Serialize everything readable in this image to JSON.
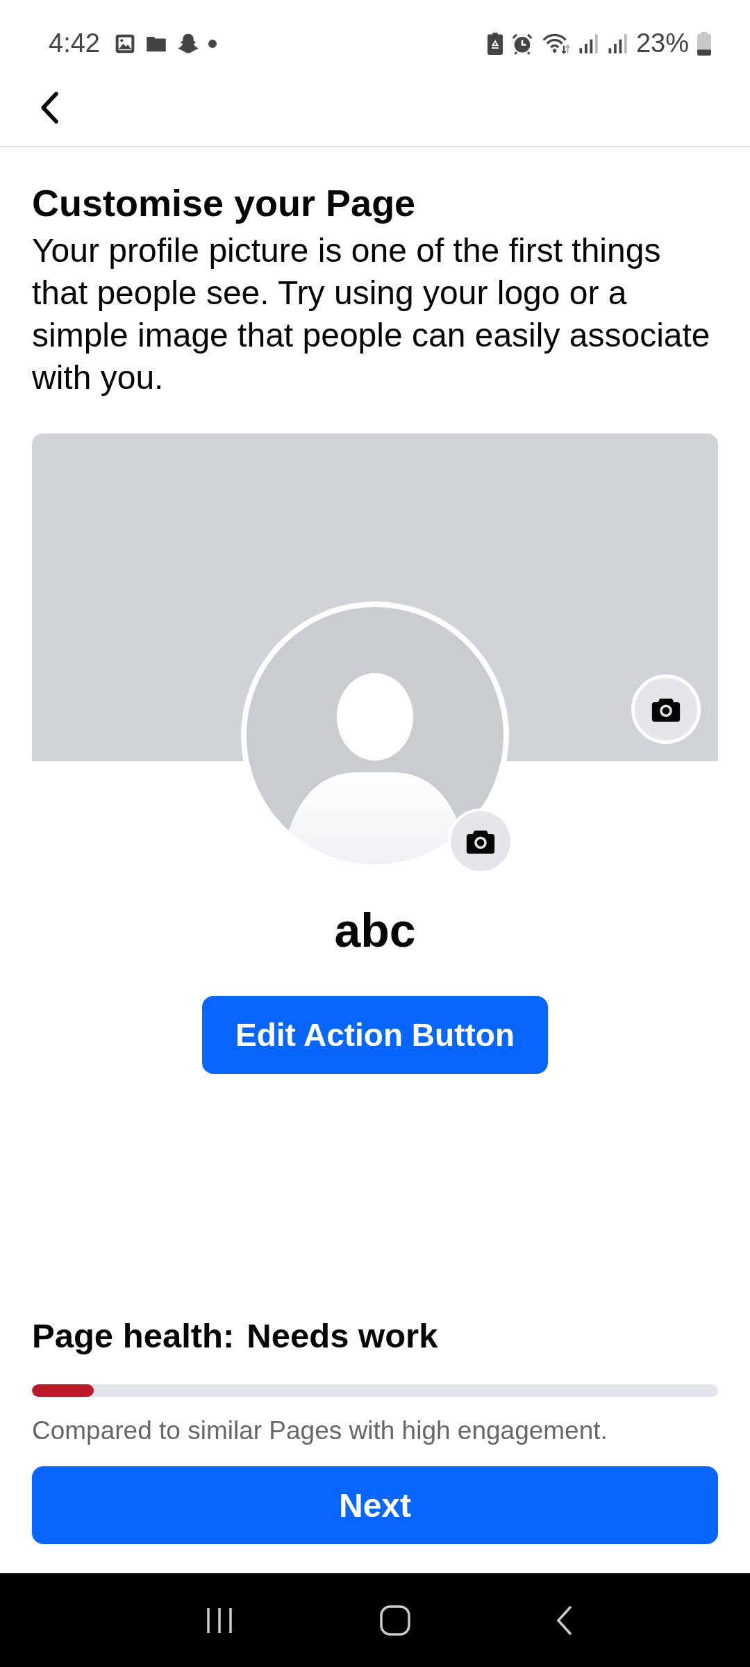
{
  "status_bar": {
    "time": "4:42",
    "battery_percent": "23%"
  },
  "page": {
    "title": "Customise your Page",
    "description": "Your profile picture is one of the first things that people see. Try using your logo or a simple image that people can easily associate with you.",
    "name": "abc",
    "action_button": "Edit Action Button"
  },
  "page_health": {
    "label": "Page health:",
    "status": "Needs work",
    "level": 0.09,
    "color": "#bb1a2b",
    "caption": "Compared to similar Pages with high engagement."
  },
  "next_button": "Next"
}
